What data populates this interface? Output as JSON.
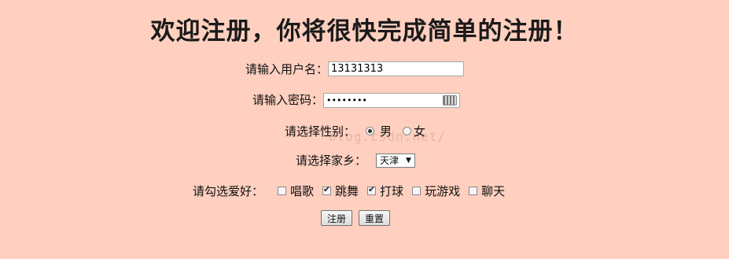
{
  "title": "欢迎注册，你将很快完成简单的注册！",
  "username": {
    "label": "请输入用户名：",
    "value": "13131313"
  },
  "password": {
    "label": "请输入密码：",
    "masked": "••••••••"
  },
  "gender": {
    "label": "请选择性别：",
    "options": [
      {
        "label": "男",
        "checked": true
      },
      {
        "label": "女",
        "checked": false
      }
    ]
  },
  "hometown": {
    "label": "请选择家乡：",
    "selected": "天津"
  },
  "hobbies": {
    "label": "请勾选爱好：",
    "options": [
      {
        "label": "唱歌",
        "checked": false
      },
      {
        "label": "跳舞",
        "checked": true
      },
      {
        "label": "打球",
        "checked": true
      },
      {
        "label": "玩游戏",
        "checked": false
      },
      {
        "label": "聊天",
        "checked": false
      }
    ]
  },
  "buttons": {
    "submit": "注册",
    "reset": "重置"
  },
  "watermark": "blog.csdn.net/",
  "icons": {
    "password_keyboard": "keyboard-icon",
    "select_arrow": "triangle-down-icon"
  }
}
